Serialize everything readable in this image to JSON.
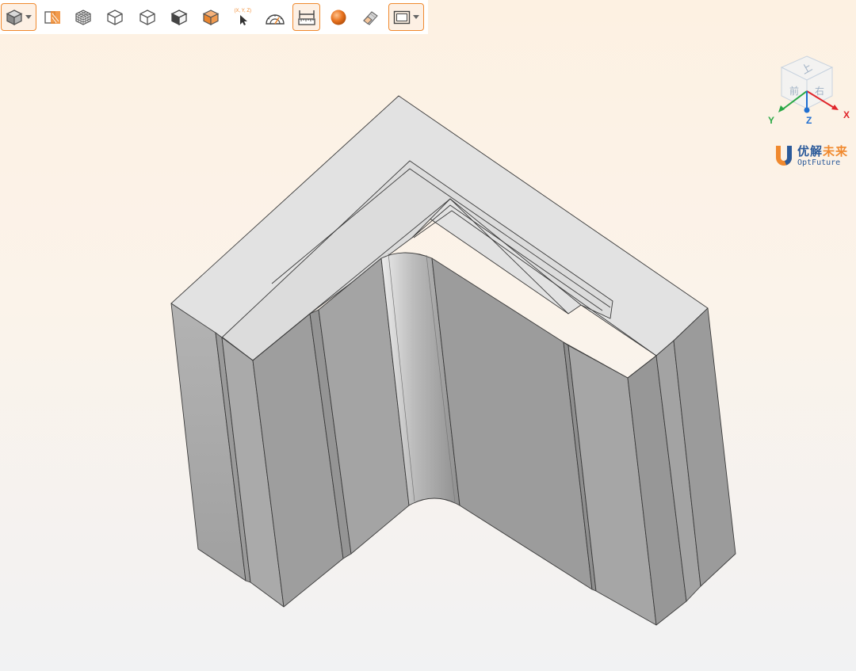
{
  "toolbar": {
    "items": [
      {
        "name": "view-mode-dropdown",
        "icon": "shaded-cube-icon",
        "active": true
      },
      {
        "name": "section-view-button",
        "icon": "section-plane-icon"
      },
      {
        "name": "mesh-view-button",
        "icon": "mesh-cube-icon"
      },
      {
        "name": "wireframe-view-button",
        "icon": "wireframe-cube-icon"
      },
      {
        "name": "hidden-line-view-button",
        "icon": "hidden-line-cube-icon"
      },
      {
        "name": "shaded-edges-view-button",
        "icon": "shaded-edges-cube-icon"
      },
      {
        "name": "shaded-view-button",
        "icon": "orange-cube-icon"
      },
      {
        "name": "pick-coordinate-button",
        "icon": "coordinate-pick-icon",
        "label": "(X, Y, Z)"
      },
      {
        "name": "measure-angle-button",
        "icon": "protractor-icon"
      },
      {
        "name": "measure-distance-button",
        "icon": "ruler-icon",
        "active": true
      },
      {
        "name": "material-sphere-button",
        "icon": "sphere-icon"
      },
      {
        "name": "clip-tool-button",
        "icon": "eraser-icon"
      },
      {
        "name": "frame-dropdown",
        "icon": "frame-icon",
        "active": true
      }
    ]
  },
  "viewcube": {
    "faces": [
      "上",
      "前",
      "右"
    ],
    "axes": {
      "x": "X",
      "y": "Y",
      "z": "Z"
    },
    "colors": {
      "x": "#e0262b",
      "y": "#2aa845",
      "z": "#1f6fd1"
    }
  },
  "logo": {
    "cn_part1": "优解",
    "cn_part2": "未来",
    "en": "OptFuture",
    "colors": {
      "blue": "#2b5a9a",
      "orange": "#f0892e"
    }
  },
  "colors": {
    "accent": "#f0892e",
    "top_face": "#e2e2e2",
    "side_face": "#a8a8a8"
  }
}
